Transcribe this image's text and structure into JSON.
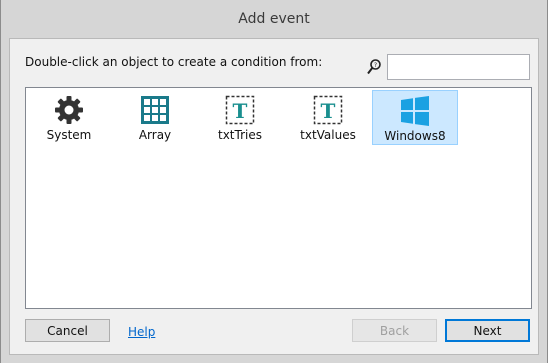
{
  "window": {
    "title": "Add event"
  },
  "prompt": "Double-click an object to create a condition from:",
  "search": {
    "value": "",
    "placeholder": "",
    "icon": "search-icon"
  },
  "objects": [
    {
      "label": "System",
      "icon": "gear-icon",
      "selected": false
    },
    {
      "label": "Array",
      "icon": "grid-icon",
      "selected": false
    },
    {
      "label": "txtTries",
      "icon": "text-object-icon",
      "selected": false
    },
    {
      "label": "txtValues",
      "icon": "text-object-icon",
      "selected": false
    },
    {
      "label": "Windows8",
      "icon": "windows-logo-icon",
      "selected": true
    }
  ],
  "buttons": {
    "cancel": "Cancel",
    "help": "Help",
    "back": "Back",
    "next": "Next"
  },
  "colors": {
    "accent": "#0078d7",
    "selection": "#cce8ff",
    "link": "#0066cc",
    "text_icon": "#1a8f8f",
    "windows_logo": "#1ba1e2"
  }
}
